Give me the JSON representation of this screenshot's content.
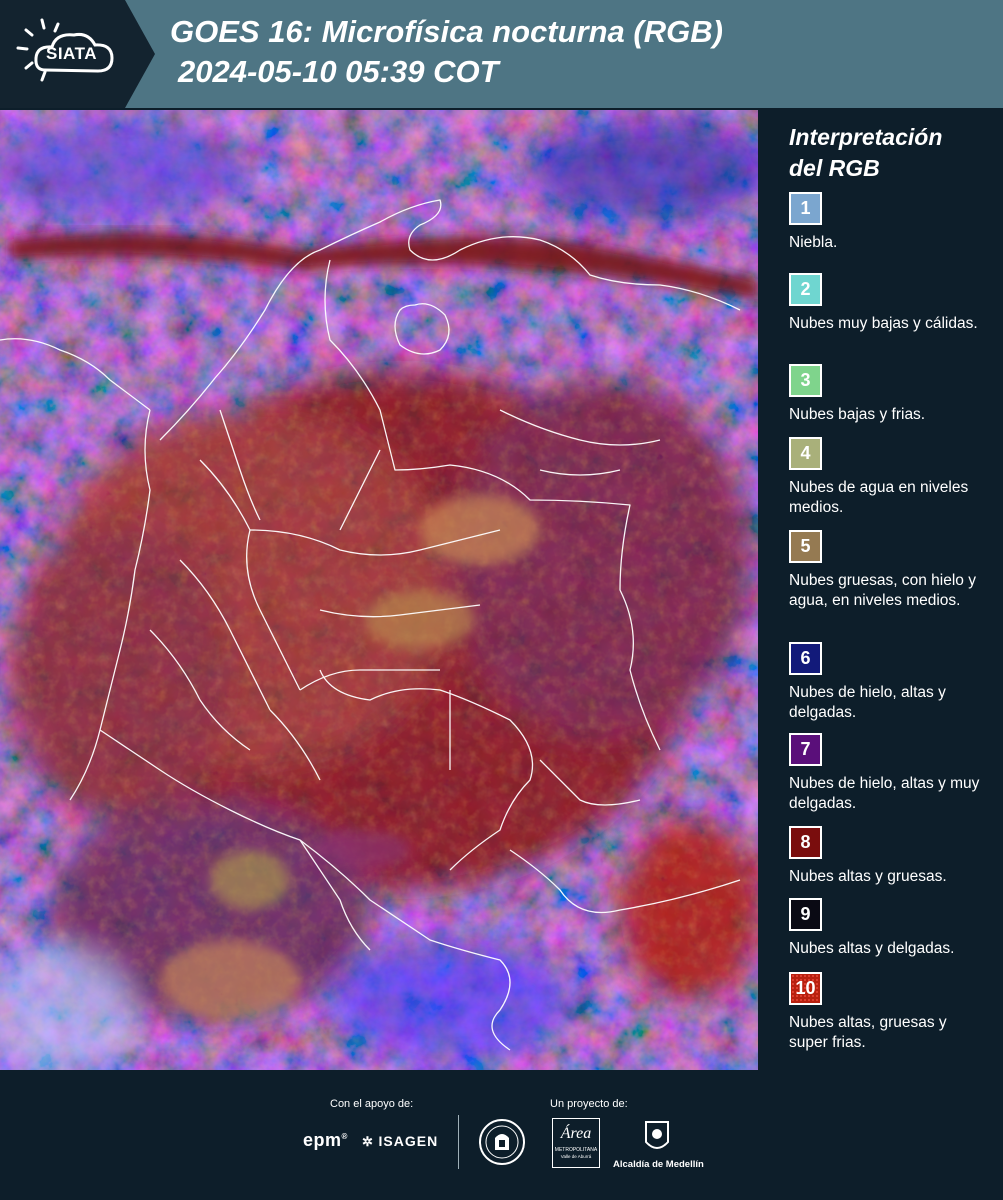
{
  "header": {
    "logo_text": "SIATA",
    "title_line1": "GOES 16: Microfísica nocturna (RGB)",
    "title_line2": "2024-05-10 05:39 COT"
  },
  "legend": {
    "title_line1": "Interpretación",
    "title_line2": "del RGB",
    "items": [
      {
        "number": "1",
        "color": "#7ba6cf",
        "label": "Niebla."
      },
      {
        "number": "2",
        "color": "#6fd6d0",
        "label": "Nubes muy bajas y cálidas."
      },
      {
        "number": "3",
        "color": "#7fd48c",
        "label": "Nubes bajas y frias."
      },
      {
        "number": "4",
        "color": "#a9b07a",
        "label": "Nubes de agua en niveles medios."
      },
      {
        "number": "5",
        "color": "#957a52",
        "label": "Nubes gruesas, con hielo y agua, en niveles medios."
      },
      {
        "number": "6",
        "color": "#121a7a",
        "label": "Nubes de hielo, altas y delgadas."
      },
      {
        "number": "7",
        "color": "#5a0f7a",
        "label": "Nubes de hielo, altas y muy delgadas."
      },
      {
        "number": "8",
        "color": "#7a0d0d",
        "label": "Nubes altas y gruesas."
      },
      {
        "number": "9",
        "color": "#0a0a14",
        "label": "Nubes altas y delgadas."
      },
      {
        "number": "10",
        "color": "#b8200f",
        "label": "Nubes altas, gruesas y super frias."
      }
    ]
  },
  "footer": {
    "support_label": "Con el apoyo de:",
    "project_label": "Un proyecto de:",
    "sponsor_epm": "epm",
    "sponsor_isagen": "ISAGEN",
    "sponsor_area": "Área",
    "sponsor_area_sub": "METROPOLITANA",
    "sponsor_area_sub2": "Valle de Aburrá",
    "sponsor_alcaldia": "Alcaldía de Medellín"
  }
}
